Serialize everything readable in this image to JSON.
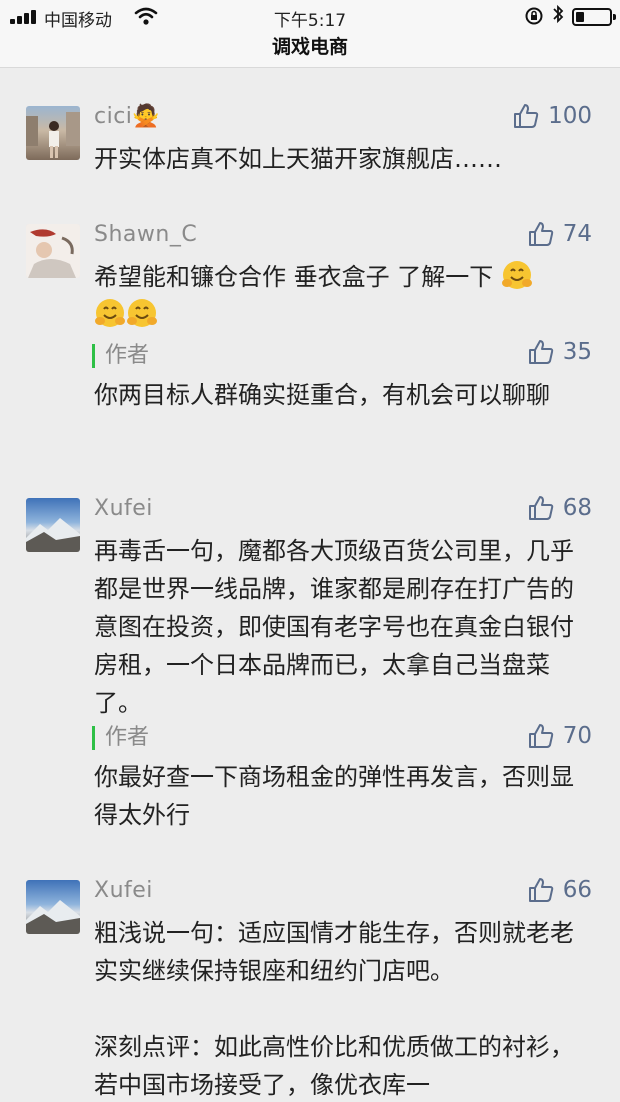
{
  "status": {
    "carrier": "中国移动",
    "time": "下午5:17",
    "battery_level": 0.25
  },
  "header": {
    "title": "调戏电商"
  },
  "comments": [
    {
      "name": "cici🙅",
      "likes": "100",
      "text": "开实体店真不如上天猫开家旗舰店……"
    },
    {
      "name": "Shawn_C",
      "likes": "74",
      "text": "希望能和镰仓合作 垂衣盒子 了解一下",
      "reply_label": "作者",
      "reply_likes": "35",
      "reply_text": "你两目标人群确实挺重合，有机会可以聊聊"
    },
    {
      "name": "Xufei",
      "likes": "68",
      "text": "再毒舌一句，魔都各大顶级百货公司里，几乎都是世界一线品牌，谁家都是刷存在打广告的意图在投资，即使国有老字号也在真金白银付房租，一个日本品牌而已，太拿自己当盘菜了。",
      "reply_label": "作者",
      "reply_likes": "70",
      "reply_text": "你最好查一下商场租金的弹性再发言，否则显得太外行"
    },
    {
      "name": "Xufei",
      "likes": "66",
      "text": "粗浅说一句：适应国情才能生存，否则就老老实实继续保持银座和纽约门店吧。",
      "text2": "深刻点评：如此高性价比和优质做工的衬衫，若中国市场接受了，像优衣库一"
    }
  ]
}
